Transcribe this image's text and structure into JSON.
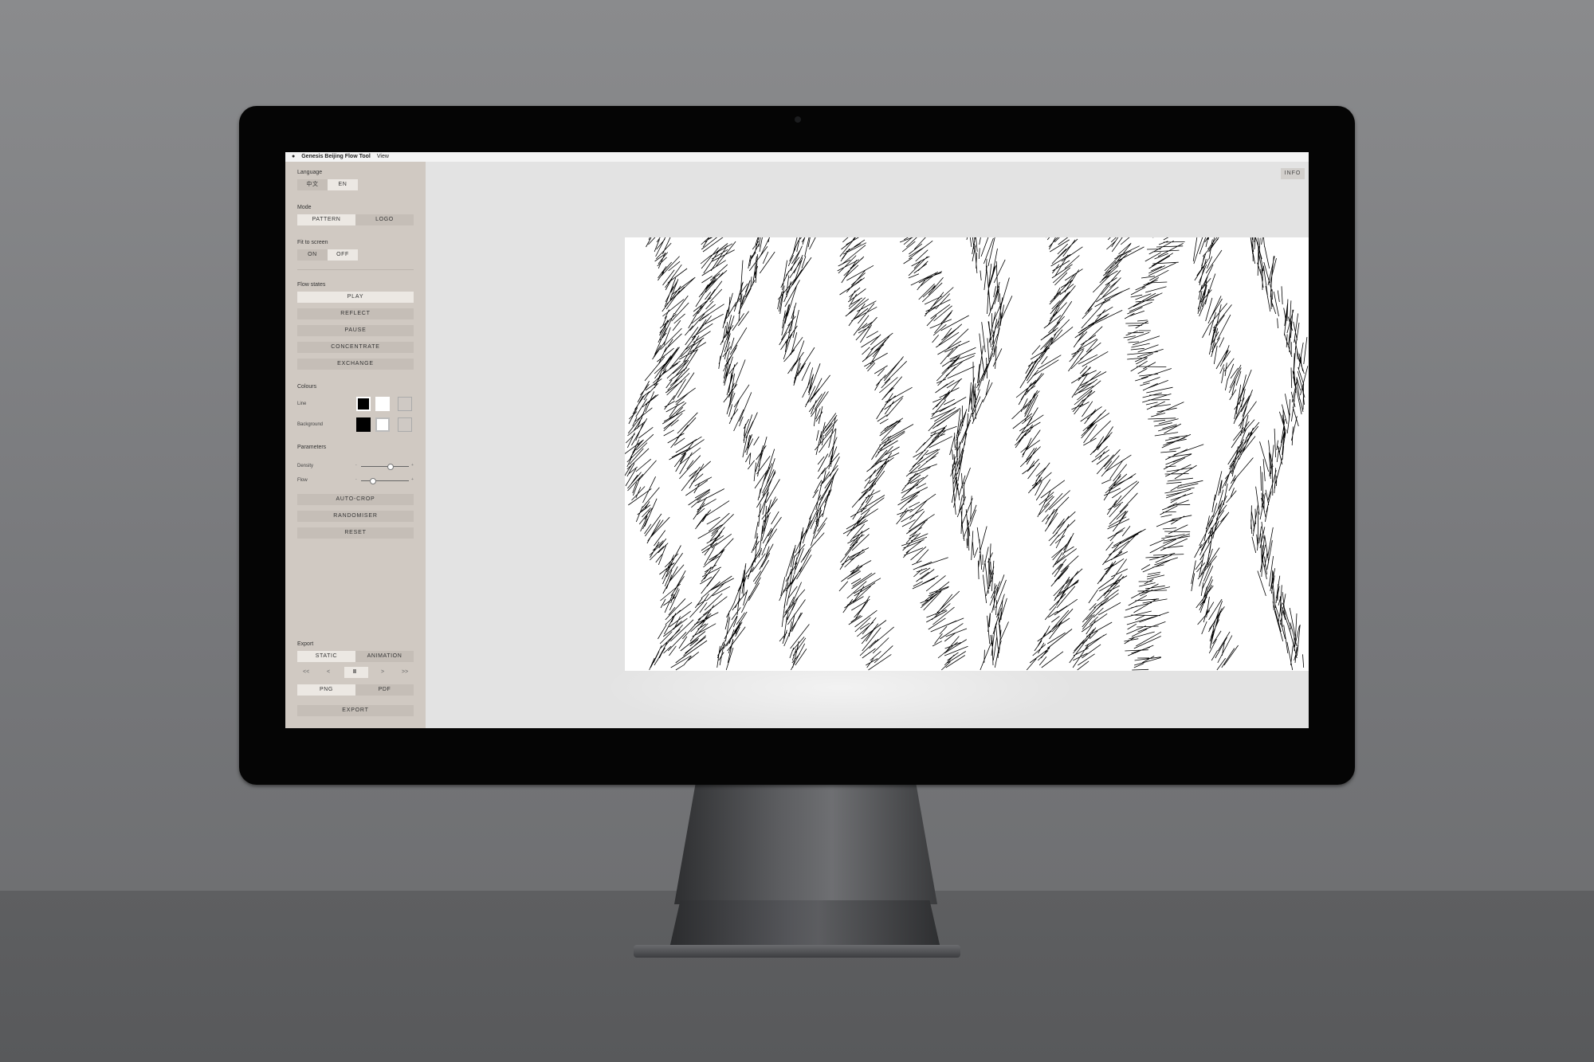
{
  "menubar": {
    "apple": "",
    "app_title": "Genesis Beijing Flow Tool",
    "menu_view": "View"
  },
  "sidebar": {
    "language": {
      "label": "Language",
      "options": [
        "中文",
        "EN"
      ],
      "selected": "EN"
    },
    "mode": {
      "label": "Mode",
      "options": [
        "PATTERN",
        "LOGO"
      ],
      "selected": "PATTERN"
    },
    "fit_to_screen": {
      "label": "Fit to screen",
      "options": [
        "ON",
        "OFF"
      ],
      "selected": "OFF"
    },
    "flow_states": {
      "label": "Flow states",
      "buttons": [
        "PLAY",
        "REFLECT",
        "PAUSE",
        "CONCENTRATE",
        "EXCHANGE"
      ],
      "selected": "PLAY"
    },
    "colours": {
      "label": "Colours",
      "line_label": "Line",
      "background_label": "Background",
      "swatches": [
        "#000000",
        "#ffffff",
        "#cfc9c4"
      ]
    },
    "parameters": {
      "label": "Parameters",
      "density_label": "Density",
      "flow_label": "Flow",
      "density_value": 0.62,
      "flow_value": 0.25,
      "minus": "-",
      "plus": "+"
    },
    "actions": [
      "AUTO-CROP",
      "RANDOMISER",
      "RESET"
    ],
    "export": {
      "label": "Export",
      "type_options": [
        "STATIC",
        "ANIMATION"
      ],
      "type_selected": "STATIC",
      "playback": [
        "<<",
        "<",
        "II",
        ">",
        ">>"
      ],
      "format_options": [
        "PNG",
        "PDF"
      ],
      "format_selected": "PNG",
      "export_button": "EXPORT"
    }
  },
  "main": {
    "info_button": "INFO"
  },
  "colors": {
    "sidebar_bg": "#d0c9c2",
    "button_bg": "#c5beb7",
    "selected_bg": "#ece8e3",
    "canvas_bg": "#ffffff",
    "line": "#000000"
  }
}
